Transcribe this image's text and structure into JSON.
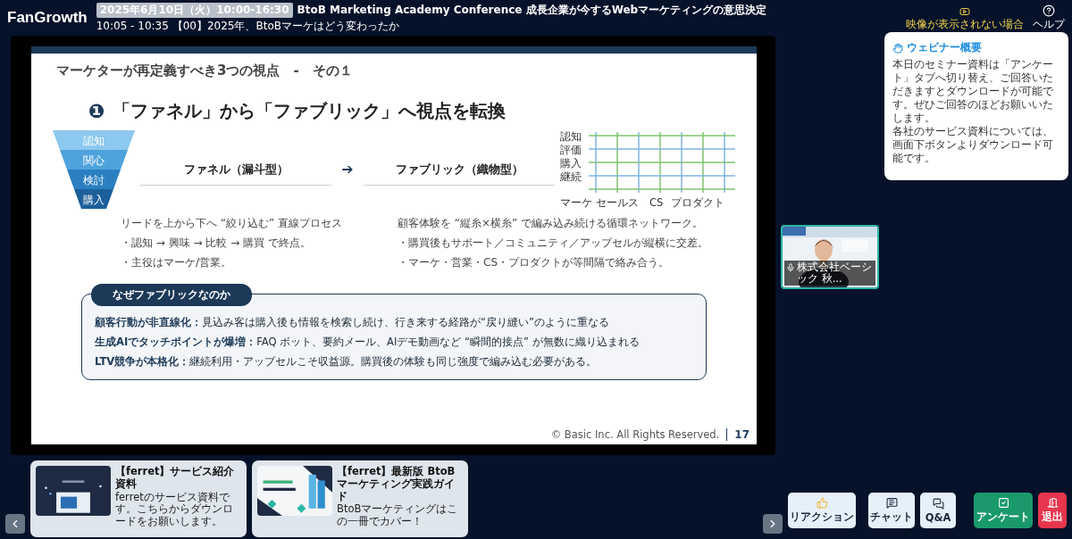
{
  "header": {
    "logo": "FanGrowth",
    "date_badge": "2025年6月10日（火）10:00-16:30",
    "conference_title": "BtoB Marketing Academy Conference 成長企業が今するWebマーケティングの意思決定",
    "session": "10:05 - 10:35 【00】2025年、BtoBマーケはどう変わったか"
  },
  "header_actions": [
    {
      "kind": "video",
      "label": "映像が表示されない場合"
    },
    {
      "kind": "help",
      "label": "ヘルプ"
    }
  ],
  "slide": {
    "title": "マーケターが再定義すべき3つの視点　-　その１",
    "number": "❶",
    "heading": "「ファネル」から「ファブリック」へ視点を転換",
    "funnel_labels": [
      "認知",
      "関心",
      "検討",
      "購入"
    ],
    "fabric_rows": [
      "認知",
      "評価",
      "購入",
      "継続"
    ],
    "fabric_columns": [
      "マーケ",
      "セールス",
      "CS",
      "プロダクト"
    ],
    "left_heading": "ファネル（漏斗型）",
    "arrow": "➔",
    "right_heading": "ファブリック（織物型）",
    "left_lines": [
      "リードを上から下へ “絞り込む” 直線プロセス",
      "・認知 → 興味 → 比較 → 購買 で終点。",
      "・主役はマーケ/営業。"
    ],
    "right_lines": [
      "顧客体験を “縦糸×横糸” で編み込み続ける循環ネットワーク。",
      "・購買後もサポート／コミュニティ／アップセルが縦横に交差。",
      "・マーケ・営業・CS・プロダクトが等間隔で絡み合う。"
    ],
    "box_label": "なぜファブリックなのか",
    "box_lines": [
      "**顧客行動が非直線化：**見込み客は購入後も情報を検索し続け、行き来する経路が“戻り縫い”のように重なる",
      "**生成AIでタッチポイントが爆増：**FAQ ボット、要約メール、AIデモ動画など “瞬間的接点” が無数に織り込まれる",
      "**LTV競争が本格化：**継続利用・アップセルこそ収益源。購買後の体験も同じ強度で編み込む必要がある。"
    ],
    "copyright": "© Basic Inc. All Rights Reserved.",
    "page": "17"
  },
  "video": {
    "caption": "株式会社ベーシック 秋..."
  },
  "overview": {
    "title": "ウェビナー概要",
    "body": [
      "本日のセミナー資料は「アンケート」タブへ切り替え、ご回答いただきますとダウンロードが可能です。ぜひご回答のほどお願いいたします。",
      "各社のサービス資料については、画面下ボタンよりダウンロード可能です。"
    ]
  },
  "materials": [
    {
      "title": "【ferret】サービス紹介資料",
      "description": "ferretのサービス資料です。こちらからダウンロードをお願いします。"
    },
    {
      "title": "【ferret】最新版 BtoBマーケティング実践ガイド",
      "description": "BtoBマーケティングはこの一冊でカバー！"
    }
  ],
  "buttons": [
    {
      "kind": "reaction",
      "label": "リアクション"
    },
    {
      "kind": "chat",
      "label": "チャット"
    },
    {
      "kind": "qa",
      "label": "Q&A"
    },
    {
      "kind": "survey",
      "label": "アンケート"
    },
    {
      "kind": "exit",
      "label": "退出"
    }
  ]
}
